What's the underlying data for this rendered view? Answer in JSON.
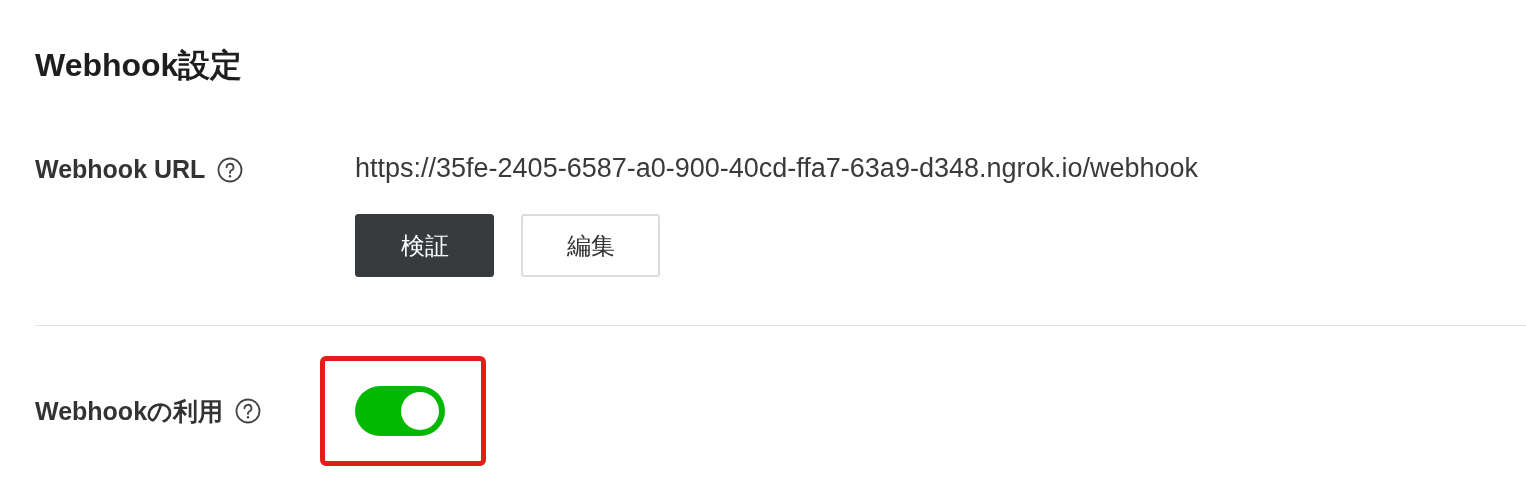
{
  "section_title": "Webhook設定",
  "webhook_url": {
    "label": "Webhook URL",
    "value": "https://35fe-2405-6587-a0-900-40cd-ffa7-63a9-d348.ngrok.io/webhook",
    "buttons": [
      {
        "label": "検証",
        "kind": "primary"
      },
      {
        "label": "編集",
        "kind": "secondary"
      }
    ]
  },
  "webhook_usage": {
    "label": "Webhookの利用",
    "on": true,
    "highlighted": true
  }
}
